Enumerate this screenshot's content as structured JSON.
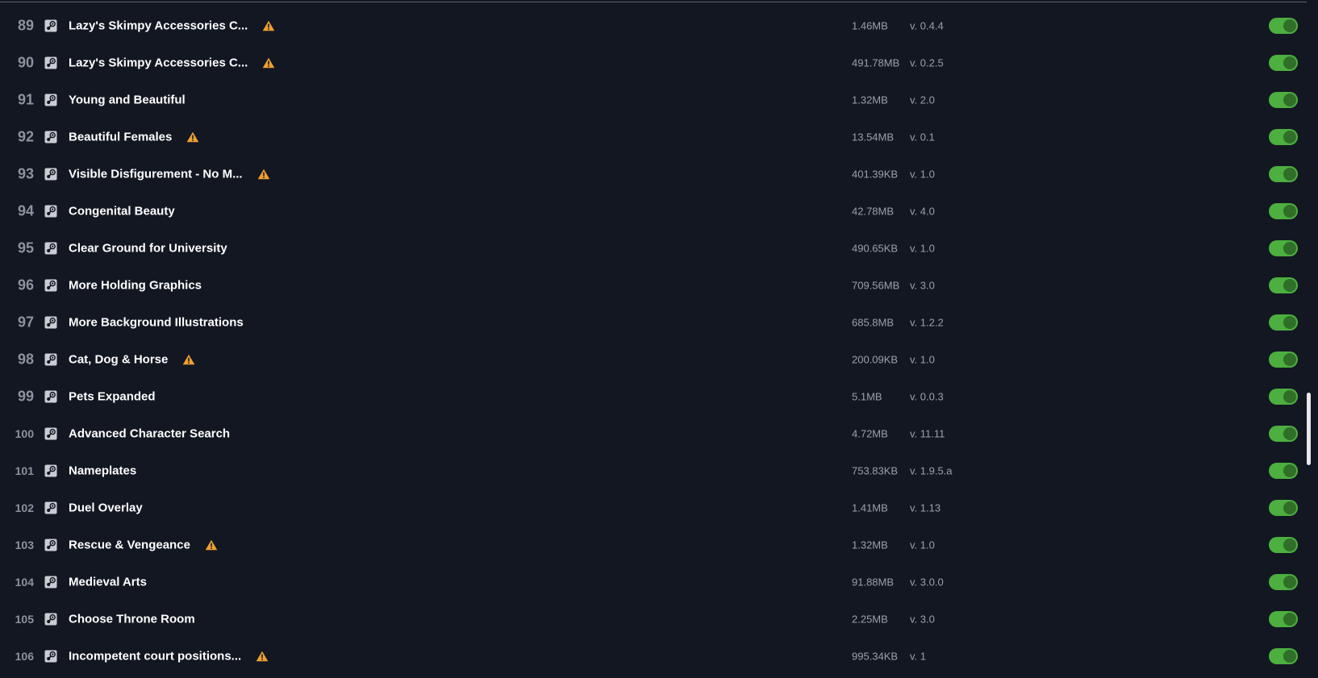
{
  "colors": {
    "background": "#131722",
    "toggle_on": "#4caf3f",
    "warning": "#f0a030",
    "name_text": "#ffffff",
    "meta_text": "#9ba0a9"
  },
  "icons": {
    "source": "steam-icon",
    "warning": "warning-icon"
  },
  "mods": [
    {
      "index": "89",
      "name": "Lazy's Skimpy Accessories C...",
      "warning": true,
      "size": "1.46MB",
      "version": "v. 0.4.4",
      "enabled": true
    },
    {
      "index": "90",
      "name": "Lazy's Skimpy Accessories C...",
      "warning": true,
      "size": "491.78MB",
      "version": "v. 0.2.5",
      "enabled": true
    },
    {
      "index": "91",
      "name": "Young and Beautiful",
      "warning": false,
      "size": "1.32MB",
      "version": "v. 2.0",
      "enabled": true
    },
    {
      "index": "92",
      "name": "Beautiful Females",
      "warning": true,
      "size": "13.54MB",
      "version": "v. 0.1",
      "enabled": true
    },
    {
      "index": "93",
      "name": "Visible Disfigurement - No M...",
      "warning": true,
      "size": "401.39KB",
      "version": "v. 1.0",
      "enabled": true
    },
    {
      "index": "94",
      "name": "Congenital Beauty",
      "warning": false,
      "size": "42.78MB",
      "version": "v. 4.0",
      "enabled": true
    },
    {
      "index": "95",
      "name": "Clear Ground for University",
      "warning": false,
      "size": "490.65KB",
      "version": "v. 1.0",
      "enabled": true
    },
    {
      "index": "96",
      "name": "More Holding Graphics",
      "warning": false,
      "size": "709.56MB",
      "version": "v. 3.0",
      "enabled": true
    },
    {
      "index": "97",
      "name": "More Background Illustrations",
      "warning": false,
      "size": "685.8MB",
      "version": "v. 1.2.2",
      "enabled": true
    },
    {
      "index": "98",
      "name": "Cat, Dog & Horse",
      "warning": true,
      "size": "200.09KB",
      "version": "v. 1.0",
      "enabled": true
    },
    {
      "index": "99",
      "name": "Pets Expanded",
      "warning": false,
      "size": "5.1MB",
      "version": "v. 0.0.3",
      "enabled": true
    },
    {
      "index": "100",
      "name": "Advanced Character Search",
      "warning": false,
      "size": "4.72MB",
      "version": "v. 11.11",
      "enabled": true
    },
    {
      "index": "101",
      "name": "Nameplates",
      "warning": false,
      "size": "753.83KB",
      "version": "v. 1.9.5.a",
      "enabled": true
    },
    {
      "index": "102",
      "name": "Duel Overlay",
      "warning": false,
      "size": "1.41MB",
      "version": "v. 1.13",
      "enabled": true
    },
    {
      "index": "103",
      "name": "Rescue & Vengeance",
      "warning": true,
      "size": "1.32MB",
      "version": "v. 1.0",
      "enabled": true
    },
    {
      "index": "104",
      "name": "Medieval Arts",
      "warning": false,
      "size": "91.88MB",
      "version": "v. 3.0.0",
      "enabled": true
    },
    {
      "index": "105",
      "name": "Choose Throne Room",
      "warning": false,
      "size": "2.25MB",
      "version": "v. 3.0",
      "enabled": true
    },
    {
      "index": "106",
      "name": "Incompetent court positions...",
      "warning": true,
      "size": "995.34KB",
      "version": "v. 1",
      "enabled": true
    }
  ]
}
